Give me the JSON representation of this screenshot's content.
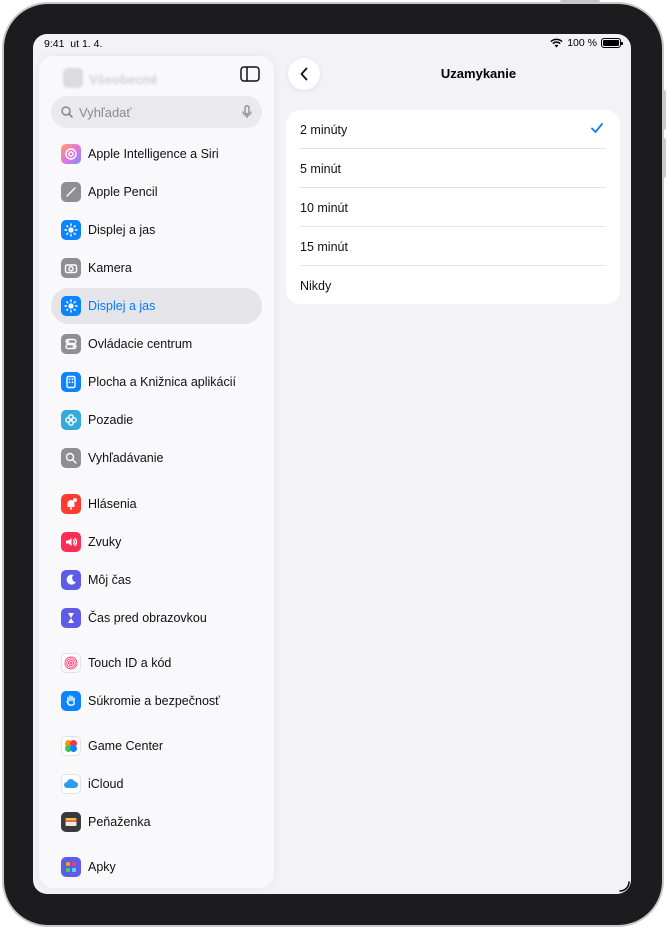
{
  "status": {
    "time": "9:41",
    "date": "ut 1. 4.",
    "battery": "100 %"
  },
  "sidebar": {
    "ghost_title": "Všeobecné",
    "search_placeholder": "Vyhľadať",
    "items": [
      {
        "label": "Apple Intelligence a Siri",
        "icon": "apple-intelligence-icon",
        "color": "#e0a0f0"
      },
      {
        "label": "Apple Pencil",
        "icon": "pencil-icon",
        "color": "#8e8e93"
      },
      {
        "label": "Displej a jas",
        "icon": "sun-icon",
        "color": "#0a84ff"
      },
      {
        "label": "Kamera",
        "icon": "camera-icon",
        "color": "#8e8e93"
      },
      {
        "label": "Displej a jas",
        "icon": "sun-icon",
        "color": "#0a84ff",
        "selected": true
      },
      {
        "label": "Ovládacie centrum",
        "icon": "toggles-icon",
        "color": "#8e8e93"
      },
      {
        "label": "Plocha a Knižnica aplikácií",
        "icon": "home-screen-icon",
        "color": "#0a84ff"
      },
      {
        "label": "Pozadie",
        "icon": "flower-icon",
        "color": "#34aadc"
      },
      {
        "label": "Vyhľadávanie",
        "icon": "magnifier-icon",
        "color": "#8e8e93"
      },
      {
        "label": "Hlásenia",
        "icon": "bell-icon",
        "color": "#ff3b30"
      },
      {
        "label": "Zvuky",
        "icon": "speaker-icon",
        "color": "#ff2d55"
      },
      {
        "label": "Môj čas",
        "icon": "moon-icon",
        "color": "#5e5ce6"
      },
      {
        "label": "Čas pred obrazovkou",
        "icon": "hourglass-icon",
        "color": "#5e5ce6"
      },
      {
        "label": "Touch ID a kód",
        "icon": "fingerprint-icon",
        "color": "#ffffff"
      },
      {
        "label": "Súkromie a bezpečnosť",
        "icon": "hand-icon",
        "color": "#0a84ff"
      },
      {
        "label": "Game Center",
        "icon": "game-center-icon",
        "color": "#ffffff"
      },
      {
        "label": "iCloud",
        "icon": "cloud-icon",
        "color": "#ffffff"
      },
      {
        "label": "Peňaženka",
        "icon": "wallet-icon",
        "color": "#3a3a3c"
      },
      {
        "label": "Apky",
        "icon": "apps-grid-icon",
        "color": "#5e5ce6"
      }
    ]
  },
  "detail": {
    "title": "Uzamykanie",
    "options": [
      {
        "label": "2 minúty",
        "selected": true
      },
      {
        "label": "5 minút",
        "selected": false
      },
      {
        "label": "10 minút",
        "selected": false
      },
      {
        "label": "15 minút",
        "selected": false
      },
      {
        "label": "Nikdy",
        "selected": false
      }
    ],
    "accent_color": "#0a7aff"
  }
}
